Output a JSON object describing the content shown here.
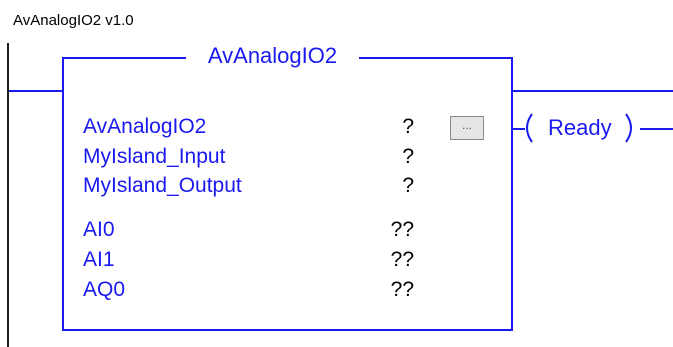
{
  "rung": {
    "title": "AvAnalogIO2 v1.0"
  },
  "block": {
    "title": "AvAnalogIO2",
    "params": [
      {
        "name": "AvAnalogIO2",
        "value": "?"
      },
      {
        "name": "MyIsland_Input",
        "value": "?"
      },
      {
        "name": "MyIsland_Output",
        "value": "?"
      },
      {
        "name": "AI0",
        "value": "??"
      },
      {
        "name": "AI1",
        "value": "??"
      },
      {
        "name": "AQ0",
        "value": "??"
      }
    ],
    "browse_label": "..."
  },
  "coil": {
    "label": "Ready"
  },
  "colors": {
    "wire": "#1a1af0",
    "rail": "#1f1f1f"
  }
}
